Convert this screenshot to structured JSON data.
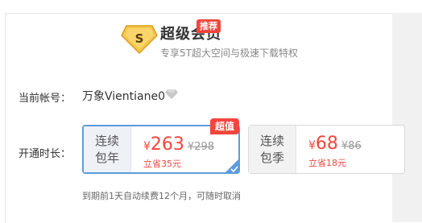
{
  "header": {
    "title": "超级会员",
    "tag": "推荐",
    "subtitle": "专享5T超大空间与极速下载特权",
    "badge_letter": "S"
  },
  "account": {
    "label": "当前帐号：",
    "name": "万象Vientiane0"
  },
  "duration": {
    "label": "开通时长："
  },
  "plans": [
    {
      "name_line1": "连续",
      "name_line2": "包年",
      "currency": "¥",
      "price": "263",
      "original": "¥298",
      "save": "立省35元",
      "tag": "超值",
      "selected": true
    },
    {
      "name_line1": "连续",
      "name_line2": "包季",
      "currency": "¥",
      "price": "68",
      "original": "¥86",
      "save": "立省18元",
      "selected": false
    }
  ],
  "footnote": "到期前1天自动续费12个月，可随时取消",
  "colors": {
    "accent_red": "#f2463d",
    "selected_border": "#5b9bde",
    "badge_gold": "#f5c74a"
  }
}
